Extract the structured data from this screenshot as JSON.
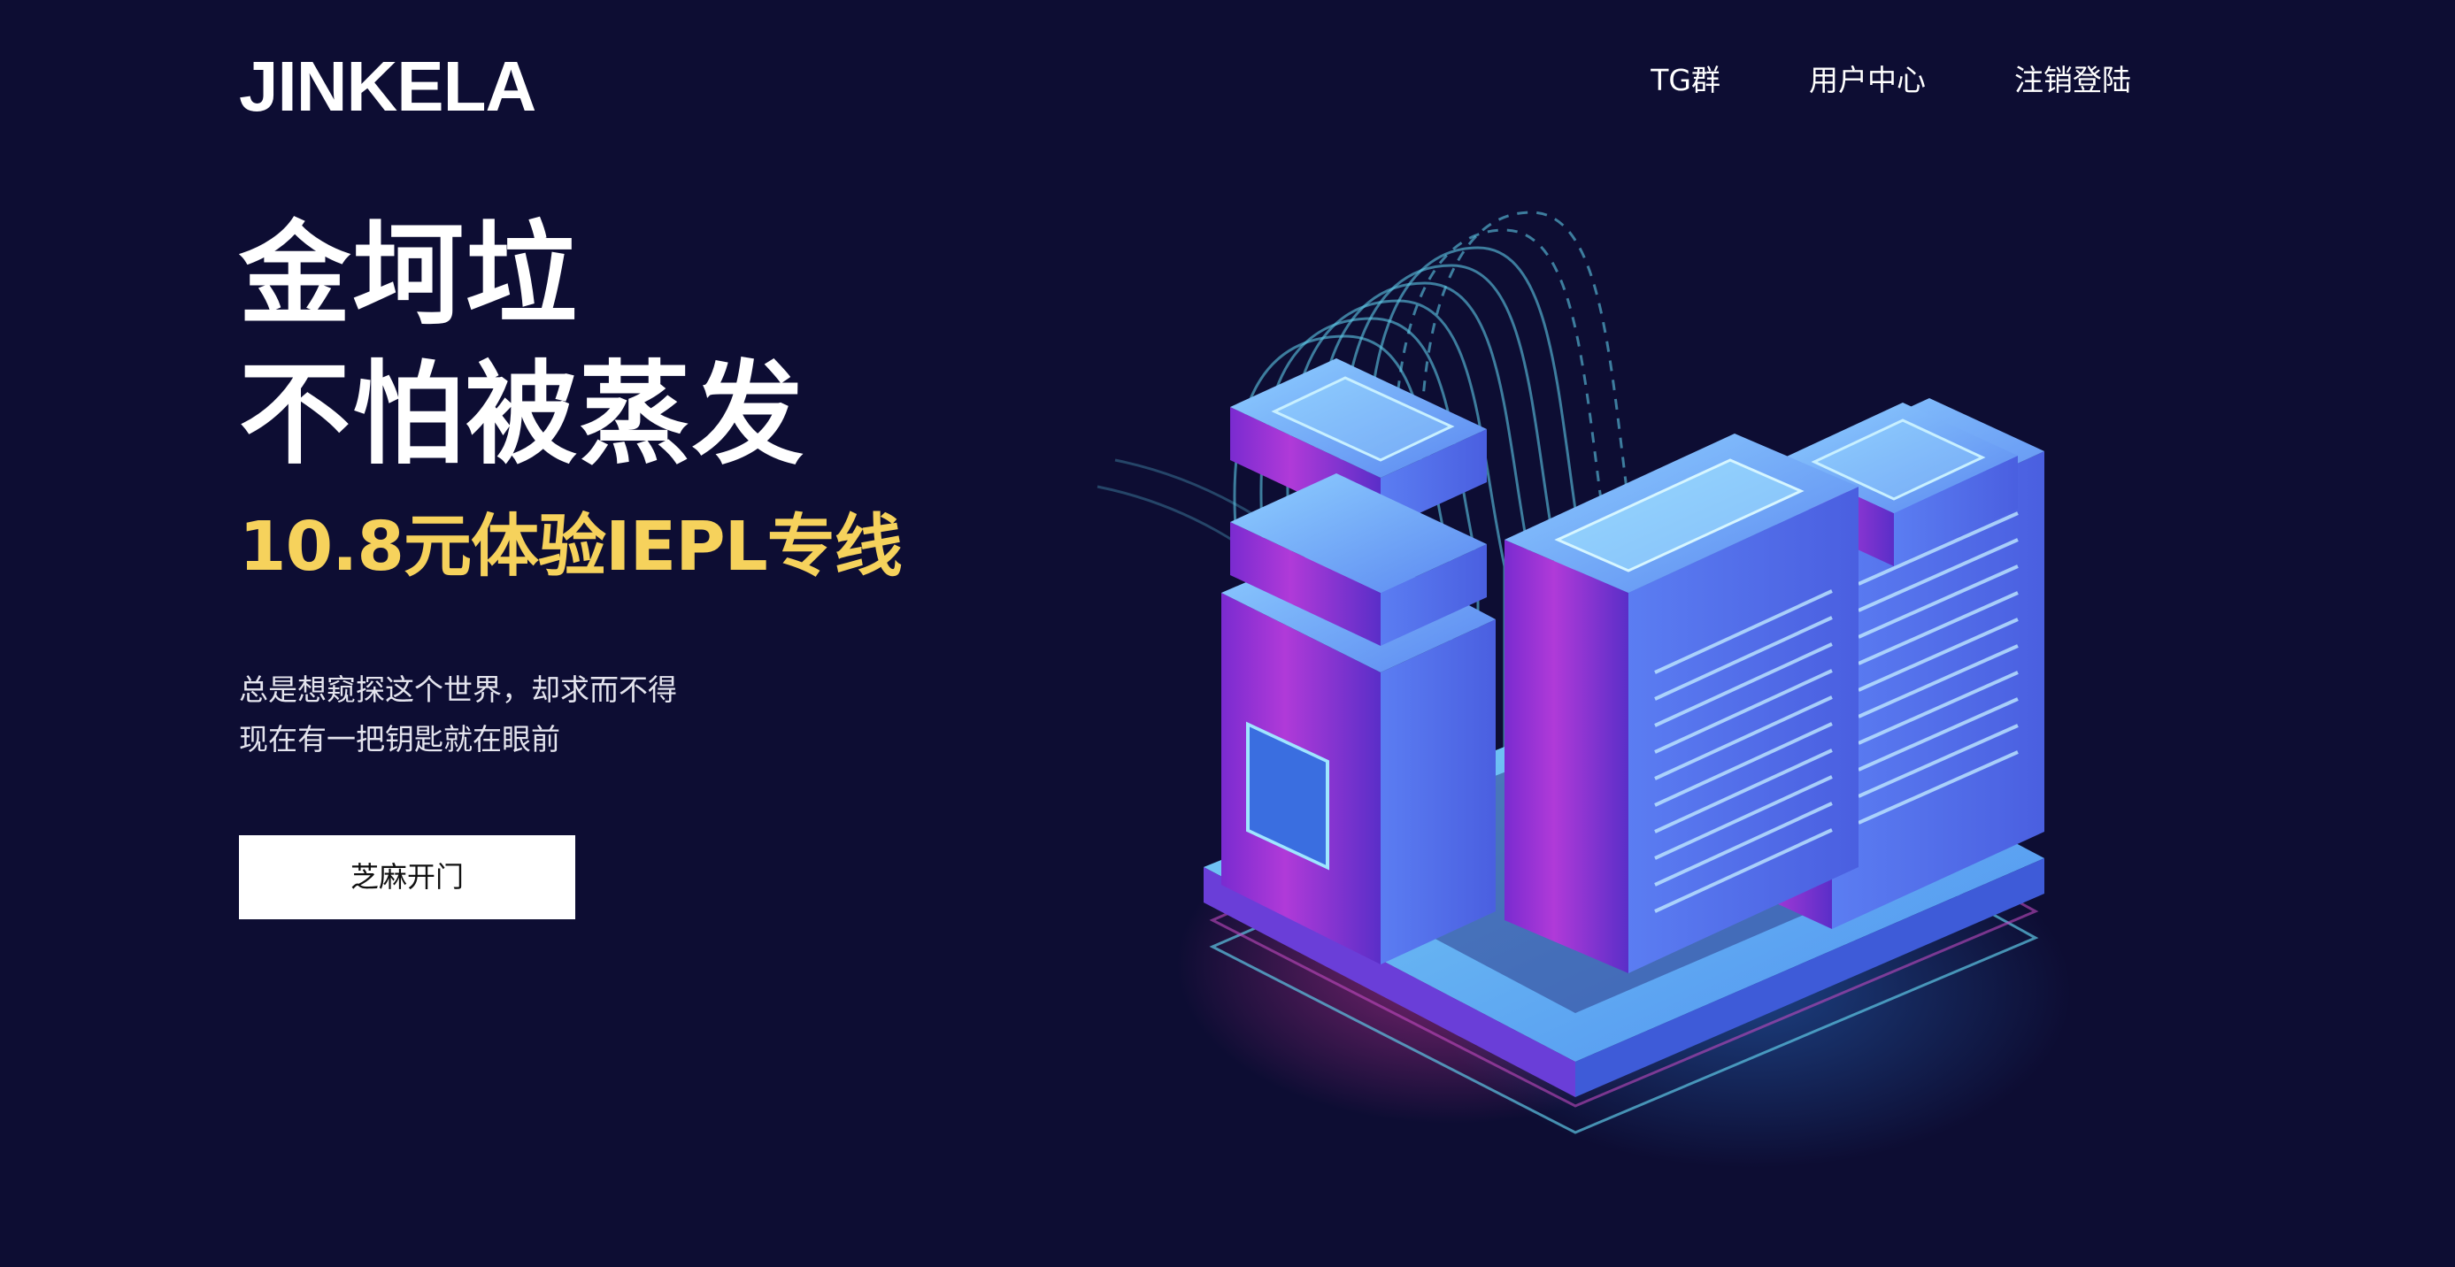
{
  "brand": {
    "logo_text": "JINKELA"
  },
  "nav": {
    "items": [
      {
        "label": "TG群"
      },
      {
        "label": "用户中心"
      },
      {
        "label": "注销登陆"
      }
    ]
  },
  "hero": {
    "title_line_1": "金坷垃",
    "title_line_2": "不怕被蒸发",
    "promo": "10.8元体验IEPL专线",
    "description_line_1": "总是想窥探这个世界，却求而不得",
    "description_line_2": "现在有一把钥匙就在眼前",
    "cta_label": "芝麻开门",
    "illustration_icon": "server-cluster-icon"
  },
  "colors": {
    "background": "#0d0d33",
    "promo_yellow": "#f6d25c",
    "button_bg": "#ffffff",
    "server_blue": "#5b8ff5",
    "server_purple": "#6a2fd6",
    "glow_pink": "#e03aa8",
    "wave_cyan": "#5ec8e6"
  }
}
